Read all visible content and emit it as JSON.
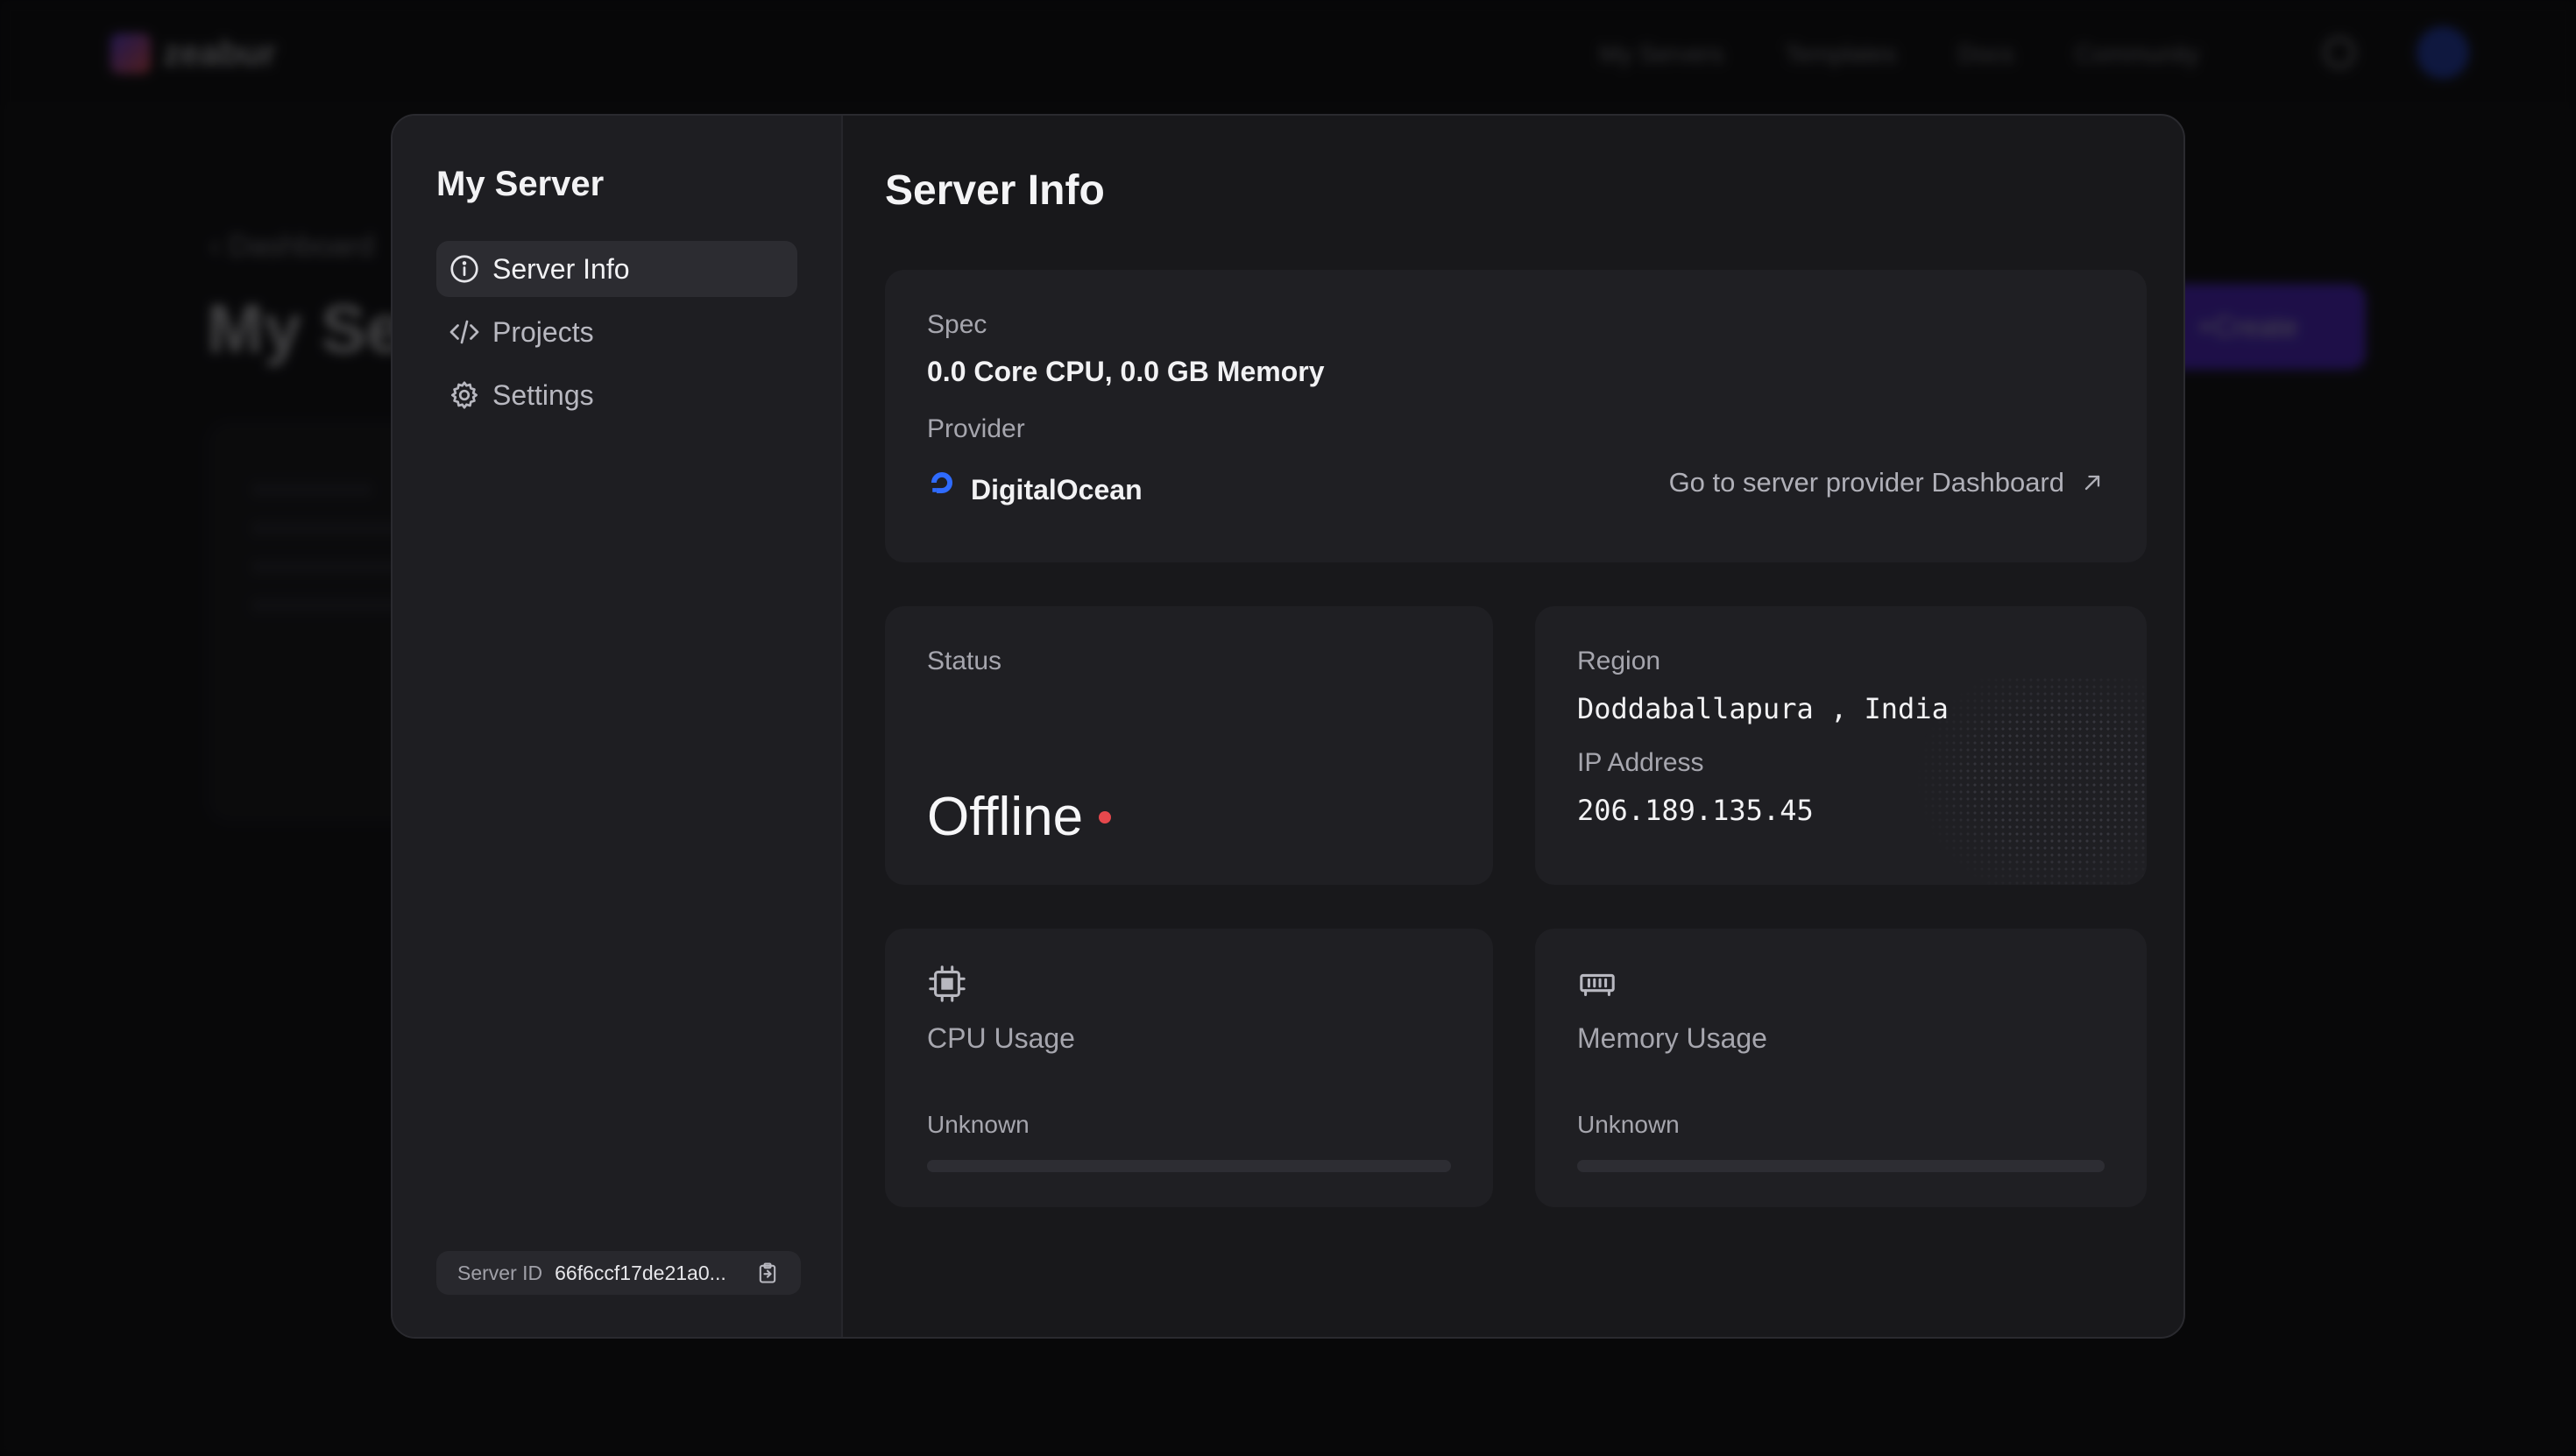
{
  "background": {
    "logo_text": "zeabur",
    "nav_links": [
      "My Servers",
      "Templates",
      "Docs",
      "Community"
    ],
    "back_link": "Dashboard",
    "page_title": "My Server",
    "create_label": "Create"
  },
  "sidebar": {
    "title": "My Server",
    "items": [
      {
        "label": "Server Info",
        "icon": "info-icon",
        "active": true
      },
      {
        "label": "Projects",
        "icon": "code-icon",
        "active": false
      },
      {
        "label": "Settings",
        "icon": "gear-icon",
        "active": false
      }
    ],
    "server_id_label": "Server ID",
    "server_id_value": "66f6ccf17de21a0..."
  },
  "main": {
    "title": "Server Info",
    "spec": {
      "label": "Spec",
      "value": "0.0 Core CPU, 0.0 GB Memory",
      "provider_label": "Provider",
      "provider_name": "DigitalOcean",
      "provider_link": "Go to server provider Dashboard"
    },
    "status": {
      "label": "Status",
      "value": "Offline",
      "color": "#e5484d"
    },
    "region": {
      "label": "Region",
      "value": "Doddaballapura , India",
      "ip_label": "IP Address",
      "ip_value": "206.189.135.45"
    },
    "cpu": {
      "label": "CPU Usage",
      "status": "Unknown",
      "icon": "cpu-icon"
    },
    "memory": {
      "label": "Memory Usage",
      "status": "Unknown",
      "icon": "memory-icon"
    }
  },
  "colors": {
    "accent": "#5b2de6",
    "provider_blue": "#2f6bff",
    "offline_dot": "#e5484d"
  }
}
